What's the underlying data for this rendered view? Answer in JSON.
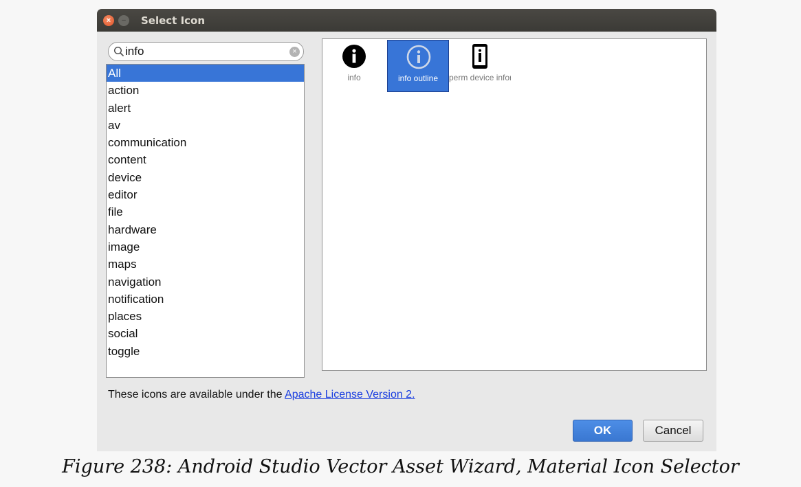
{
  "window": {
    "title": "Select Icon"
  },
  "search": {
    "value": "info"
  },
  "categories": {
    "items": [
      "All",
      "action",
      "alert",
      "av",
      "communication",
      "content",
      "device",
      "editor",
      "file",
      "hardware",
      "image",
      "maps",
      "navigation",
      "notification",
      "places",
      "social",
      "toggle"
    ],
    "selected": "All"
  },
  "icons": [
    {
      "label": "info",
      "icon": "info-icon",
      "selected": false
    },
    {
      "label": "info outline",
      "icon": "info-outline-icon",
      "selected": true
    },
    {
      "label": "perm device information",
      "icon": "perm-device-information-icon",
      "selected": false
    }
  ],
  "license": {
    "text": "These icons are available under the ",
    "link": "Apache License Version 2."
  },
  "buttons": {
    "ok": "OK",
    "cancel": "Cancel"
  },
  "caption": "Figure 238: Android Studio Vector Asset Wizard, Material Icon Selector",
  "colors": {
    "selection": "#3875d7",
    "titlebar": "#3c3b37",
    "link": "#1a3ee0"
  }
}
